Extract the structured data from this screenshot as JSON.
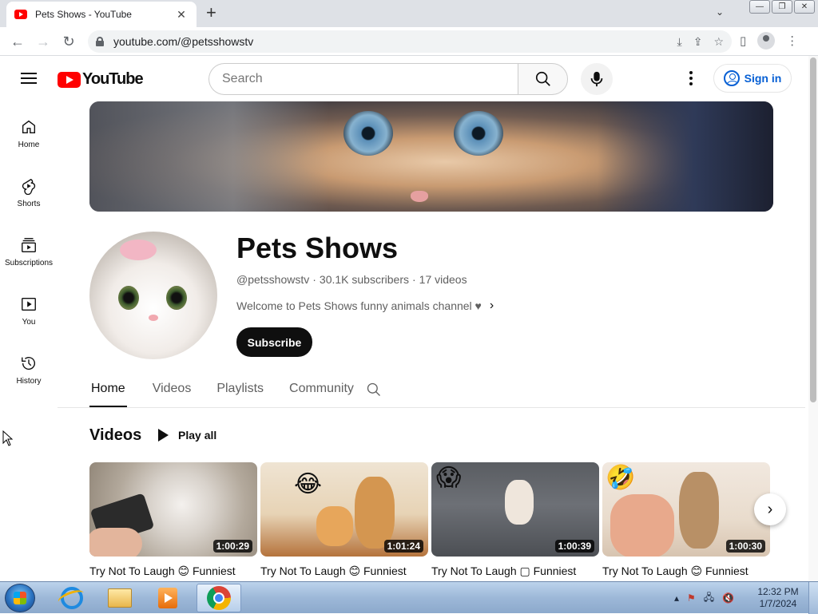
{
  "browser": {
    "tab_title": "Pets Shows - YouTube",
    "tab_close": "✕",
    "new_tab": "+",
    "url": "youtube.com/@petsshowstv",
    "back": "←",
    "forward": "→",
    "reload": "↻"
  },
  "header": {
    "logo_text": "YouTube",
    "search_placeholder": "Search",
    "signin_label": "Sign in"
  },
  "sidebar": {
    "items": [
      {
        "label": "Home",
        "icon": "home-icon"
      },
      {
        "label": "Shorts",
        "icon": "shorts-icon"
      },
      {
        "label": "Subscriptions",
        "icon": "subscriptions-icon"
      },
      {
        "label": "You",
        "icon": "you-icon"
      },
      {
        "label": "History",
        "icon": "history-icon"
      }
    ]
  },
  "channel": {
    "name": "Pets Shows",
    "handle": "@petsshowstv",
    "subscribers": "30.1K subscribers",
    "video_count": "17 videos",
    "separator": "·",
    "description": "Welcome to Pets Shows funny animals channel ♥",
    "subscribe_label": "Subscribe"
  },
  "tabs": [
    {
      "label": "Home",
      "active": true
    },
    {
      "label": "Videos",
      "active": false
    },
    {
      "label": "Playlists",
      "active": false
    },
    {
      "label": "Community",
      "active": false
    }
  ],
  "shelf": {
    "title": "Videos",
    "play_all_label": "Play all",
    "videos": [
      {
        "title": "Try Not To Laugh 😊 Funniest",
        "duration": "1:00:29"
      },
      {
        "title": "Try Not To Laugh 😊 Funniest",
        "duration": "1:01:24"
      },
      {
        "title": "Try Not To Laugh ▢ Funniest",
        "duration": "1:00:39"
      },
      {
        "title": "Try Not To Laugh 😊 Funniest",
        "duration": "1:00:30"
      }
    ]
  },
  "taskbar": {
    "time": "12:32 PM",
    "date": "1/7/2024"
  },
  "colors": {
    "youtube_red": "#ff0000",
    "link_blue": "#065fd4",
    "text_primary": "#0f0f0f",
    "text_secondary": "#606060"
  }
}
